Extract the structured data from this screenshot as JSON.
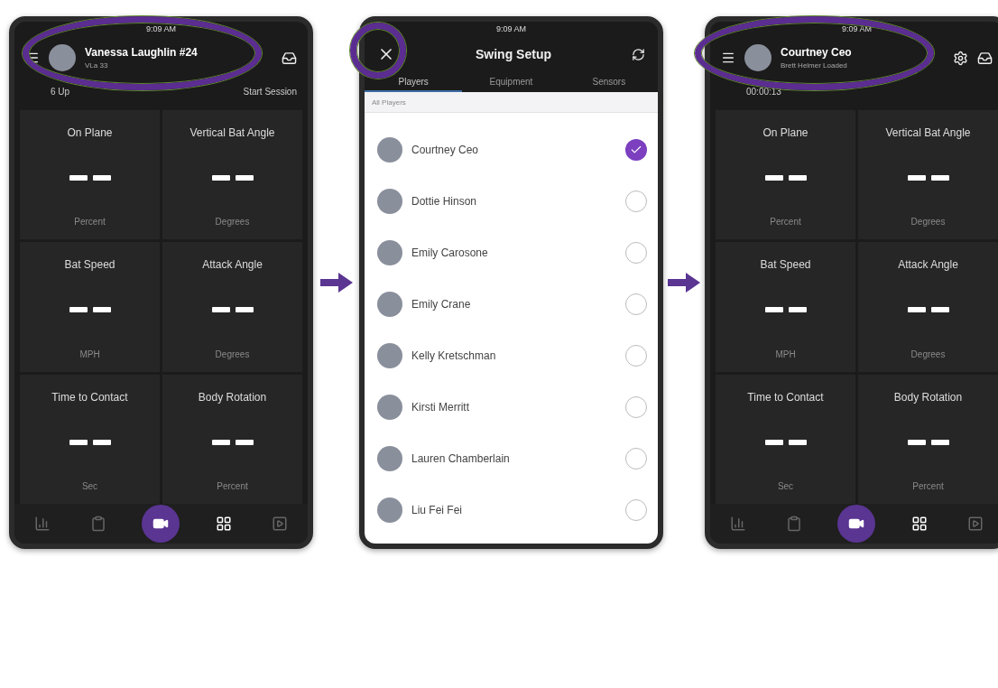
{
  "phones": [
    {
      "kind": "dashboard",
      "status_time": "9:09 AM",
      "header": {
        "name": "Vanessa Laughlin #24",
        "subtitle": "VLa 33",
        "highlighted": true
      },
      "session_bar": [
        "6 Up",
        "Start Session"
      ],
      "tiles": [
        {
          "title": "On Plane",
          "unit": "Percent"
        },
        {
          "title": "Vertical Bat Angle",
          "unit": "Degrees"
        },
        {
          "title": "Bat Speed",
          "unit": "MPH"
        },
        {
          "title": "Attack Angle",
          "unit": "Degrees"
        },
        {
          "title": "Time to Contact",
          "unit": "Sec"
        },
        {
          "title": "Body Rotation",
          "unit": "Percent"
        }
      ],
      "nav": [
        {
          "kind": "stats",
          "selected": false
        },
        {
          "kind": "clipboard",
          "selected": false
        },
        {
          "kind": "camera",
          "selected": false
        },
        {
          "kind": "grid",
          "selected": true
        },
        {
          "kind": "media",
          "selected": false
        }
      ]
    },
    {
      "kind": "setup",
      "status_time": "9:09 AM",
      "title": "Swing Setup",
      "close_highlighted": true,
      "tabs": [
        {
          "label": "Players",
          "selected": true
        },
        {
          "label": "Equipment",
          "selected": false
        },
        {
          "label": "Sensors",
          "selected": false
        }
      ],
      "section": "All Players",
      "players": [
        {
          "name": "Courtney Ceo",
          "selected": true
        },
        {
          "name": "Dottie Hinson",
          "selected": false
        },
        {
          "name": "Emily Carosone",
          "selected": false
        },
        {
          "name": "Emily Crane",
          "selected": false
        },
        {
          "name": "Kelly Kretschman",
          "selected": false
        },
        {
          "name": "Kirsti Merritt",
          "selected": false
        },
        {
          "name": "Lauren Chamberlain",
          "selected": false
        },
        {
          "name": "Liu Fei Fei",
          "selected": false
        }
      ]
    },
    {
      "kind": "dashboard",
      "status_time": "9:09 AM",
      "header": {
        "name": "Courtney Ceo",
        "subtitle": "Brett Helmer Loaded",
        "highlighted": true,
        "settings_icon": true
      },
      "session_bar": [
        "00:00:13"
      ],
      "tiles": [
        {
          "title": "On Plane",
          "unit": "Percent"
        },
        {
          "title": "Vertical Bat Angle",
          "unit": "Degrees"
        },
        {
          "title": "Bat Speed",
          "unit": "MPH"
        },
        {
          "title": "Attack Angle",
          "unit": "Degrees"
        },
        {
          "title": "Time to Contact",
          "unit": "Sec"
        },
        {
          "title": "Body Rotation",
          "unit": "Percent"
        }
      ],
      "nav": [
        {
          "kind": "stats",
          "selected": false
        },
        {
          "kind": "clipboard",
          "selected": false
        },
        {
          "kind": "camera",
          "selected": false
        },
        {
          "kind": "grid",
          "selected": true
        },
        {
          "kind": "media",
          "selected": false
        }
      ]
    }
  ]
}
